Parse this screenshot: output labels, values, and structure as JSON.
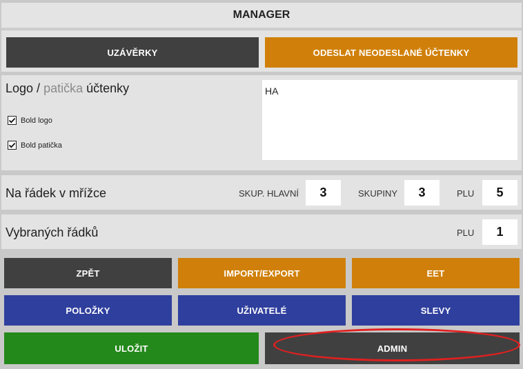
{
  "header": {
    "title": "MANAGER"
  },
  "top_buttons": {
    "closures": "UZÁVĚRKY",
    "send_unsent": "ODESLAT NEODESLANÉ ÚČTENKY"
  },
  "receipt": {
    "title_part1": "Logo /",
    "title_part2": "patička",
    "title_part3": "účtenky",
    "bold_logo_label": "Bold logo",
    "bold_footer_label": "Bold patička",
    "bold_logo_checked": true,
    "bold_footer_checked": true,
    "text_value": "HA"
  },
  "grid_rows": {
    "title": "Na řádek v mřížce",
    "main_groups_label": "SKUP. HLAVNÍ",
    "main_groups_value": "3",
    "groups_label": "SKUPINY",
    "groups_value": "3",
    "plu_label": "PLU",
    "plu_value": "5"
  },
  "selected_rows": {
    "title": "Vybraných řádků",
    "plu_label": "PLU",
    "plu_value": "1"
  },
  "bottom_buttons": {
    "back": "ZPĚT",
    "import_export": "IMPORT/EXPORT",
    "eet": "EET",
    "items": "POLOŽKY",
    "users": "UŽIVATELÉ",
    "discounts": "SLEVY",
    "save": "ULOŽIT",
    "admin": "ADMIN"
  },
  "colors": {
    "dark": "#404040",
    "orange": "#d0800a",
    "blue": "#2f3f9e",
    "green": "#24891b",
    "highlight_ring": "#e02020"
  }
}
